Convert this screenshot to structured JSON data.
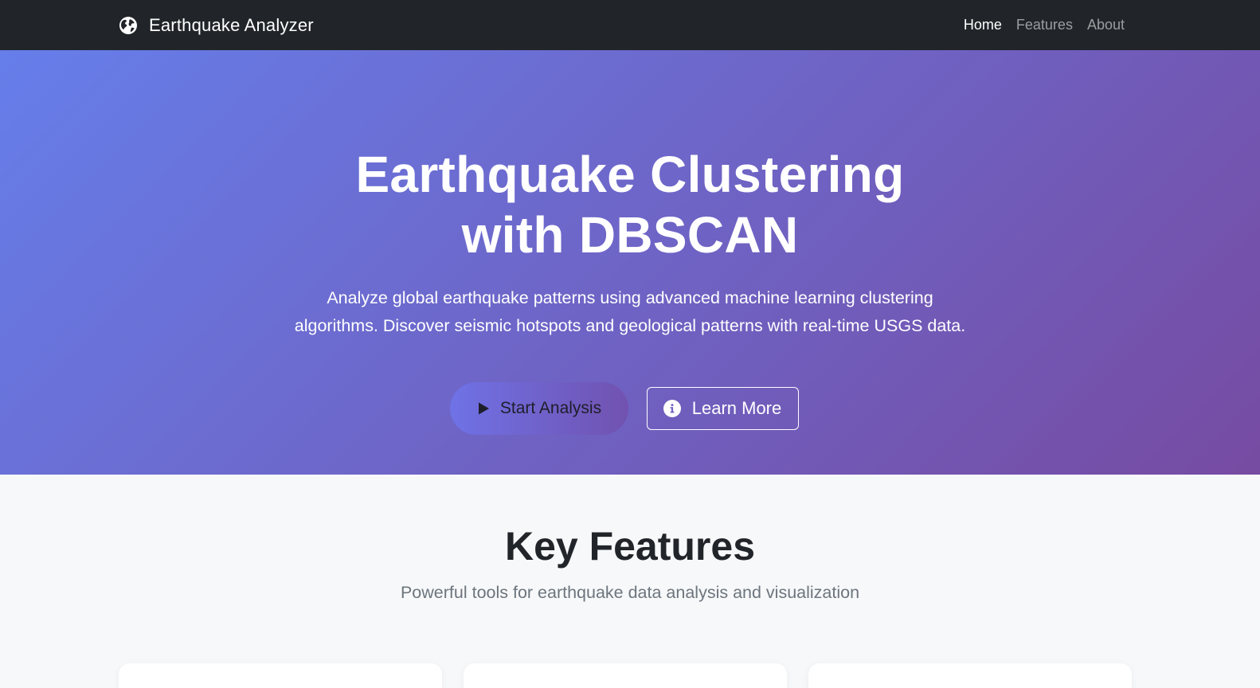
{
  "navbar": {
    "brand": {
      "icon": "globe-icon",
      "text": "Earthquake Analyzer"
    },
    "links": [
      {
        "label": "Home",
        "active": true
      },
      {
        "label": "Features",
        "active": false
      },
      {
        "label": "About",
        "active": false
      }
    ]
  },
  "hero": {
    "title_line1": "Earthquake Clustering",
    "title_line2": "with DBSCAN",
    "subtitle_line1": "Analyze global earthquake patterns using advanced machine learning clustering",
    "subtitle_line2": "algorithms. Discover seismic hotspots and geological patterns with real-time USGS data.",
    "start_button": {
      "icon": "play-icon",
      "label": "Start Analysis"
    },
    "learn_button": {
      "icon": "info-circle-icon",
      "label": "Learn More"
    },
    "gradient": [
      "#667eea",
      "#764ba2"
    ]
  },
  "features": {
    "title": "Key Features",
    "subtitle": "Powerful tools for earthquake data analysis and visualization"
  },
  "colors": {
    "navbar_bg": "#212529",
    "page_bg": "#f7f8fa",
    "heading": "#212529",
    "muted": "#6c757d"
  }
}
